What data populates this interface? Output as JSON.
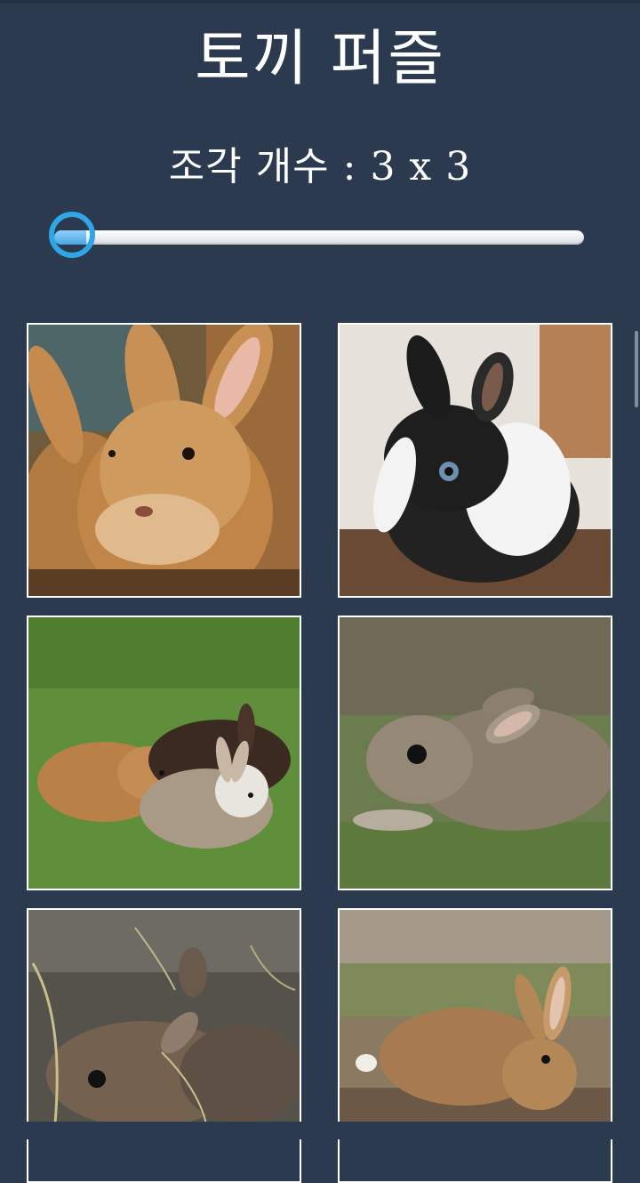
{
  "app": {
    "title": "토끼 퍼즐"
  },
  "settings": {
    "pieces_label": "조각 개수 : 3 x 3",
    "slider_value_fraction": 0.0
  },
  "gallery": {
    "items": [
      {
        "subject": "orange-brown rabbit close-up"
      },
      {
        "subject": "black and white fluffy bunny"
      },
      {
        "subject": "three rabbits on grass"
      },
      {
        "subject": "gray baby rabbit on grass"
      },
      {
        "subject": "baby rabbits in nest"
      },
      {
        "subject": "brown rabbit on ground"
      }
    ]
  },
  "colors": {
    "background": "#2b3a4f",
    "accent": "#31a6e6",
    "text": "#ffffff"
  }
}
